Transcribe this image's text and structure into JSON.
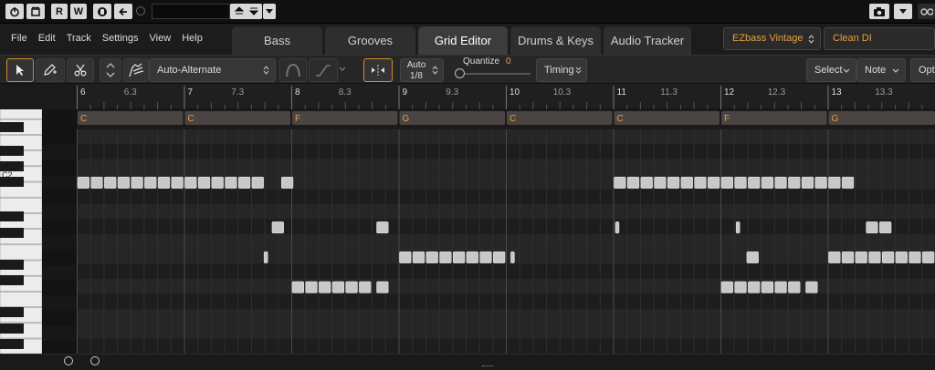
{
  "transport": {
    "buttons": [
      "R",
      "W"
    ],
    "position_value": ""
  },
  "menu": [
    "File",
    "Edit",
    "Track",
    "Settings",
    "View",
    "Help"
  ],
  "tabs": [
    {
      "label": "Bass",
      "active": false
    },
    {
      "label": "Grooves",
      "active": false
    },
    {
      "label": "Grid Editor",
      "active": true
    },
    {
      "label": "Drums & Keys",
      "active": false
    },
    {
      "label": "Audio Tracker",
      "active": false
    }
  ],
  "instrument": {
    "name": "EZbass Vintage",
    "preset": "Clean DI",
    "accent": "#e8a040"
  },
  "toolbar": {
    "articulation": "Auto-Alternate",
    "grid_top": "Auto",
    "grid_bottom": "1/8",
    "quantize_label": "Quantize",
    "quantize_value": "0",
    "timing_label": "Timing",
    "select_label": "Select",
    "note_label": "Note",
    "options_label": "Opt"
  },
  "ruler": {
    "bars": [
      "6",
      "7",
      "8",
      "9",
      "10",
      "11",
      "12",
      "13"
    ],
    "beats": [
      "6.3",
      "7.3",
      "8.3",
      "9.3",
      "10.3",
      "11.3",
      "12.3",
      "13.3"
    ]
  },
  "chords": [
    "C",
    "C",
    "F",
    "G",
    "C",
    "C",
    "F",
    "G"
  ],
  "keys": {
    "label_c2": "C2"
  },
  "colors": {
    "note": "#c8c8c8",
    "chord_block": "#4a4442",
    "chord_text": "#e8a040",
    "grid_bg": "#222222"
  }
}
